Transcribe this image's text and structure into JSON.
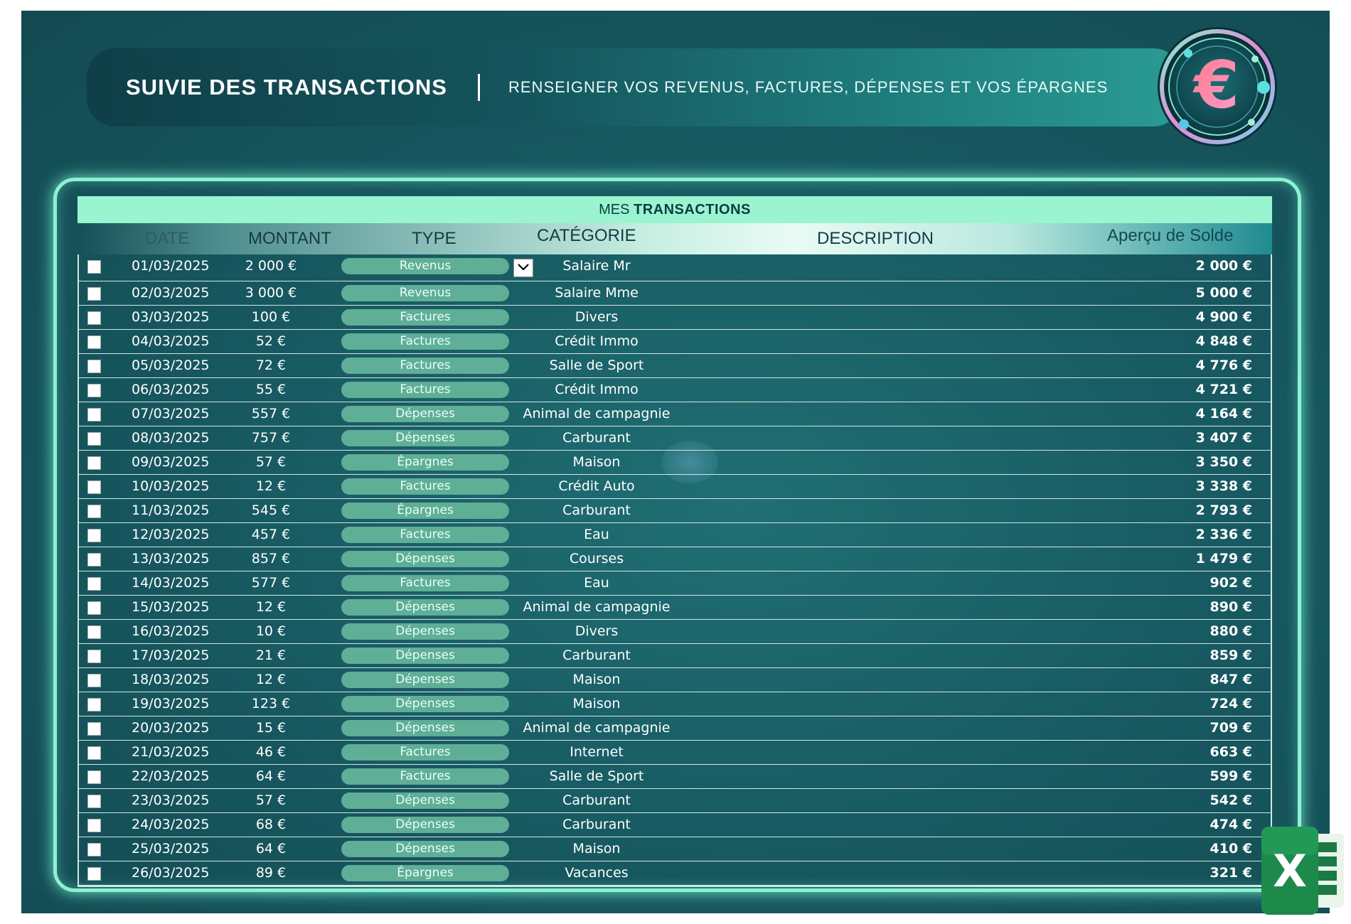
{
  "banner": {
    "title": "SUIVIE DES TRANSACTIONS",
    "subtitle": "RENSEIGNER VOS REVENUS, FACTURES, DÉPENSES ET VOS ÉPARGNES"
  },
  "icons": {
    "logo": "euro-coin-logo-icon",
    "excel": "excel-icon",
    "dropdown": "chevron-down-icon"
  },
  "colors": {
    "accent": "#9af4cf",
    "pill": "#5fae96",
    "background": "#17575f"
  },
  "table": {
    "title_prefix": "MES",
    "title_main": "TRANSACTIONS",
    "headers": {
      "date": "DATE",
      "amount": "MONTANT",
      "type": "TYPE",
      "category": "CATÉGORIE",
      "description": "DESCRIPTION",
      "balance": "Aperçu de Solde"
    },
    "rows": [
      {
        "date": "01/03/2025",
        "amount": "2 000 €",
        "type": "Revenus",
        "category": "Salaire Mr",
        "balance": "2 000 €"
      },
      {
        "date": "02/03/2025",
        "amount": "3 000 €",
        "type": "Revenus",
        "category": "Salaire Mme",
        "balance": "5 000 €"
      },
      {
        "date": "03/03/2025",
        "amount": "100 €",
        "type": "Factures",
        "category": "Divers",
        "balance": "4 900 €"
      },
      {
        "date": "04/03/2025",
        "amount": "52 €",
        "type": "Factures",
        "category": "Crédit Immo",
        "balance": "4 848 €"
      },
      {
        "date": "05/03/2025",
        "amount": "72 €",
        "type": "Factures",
        "category": "Salle de Sport",
        "balance": "4 776 €"
      },
      {
        "date": "06/03/2025",
        "amount": "55 €",
        "type": "Factures",
        "category": "Crédit Immo",
        "balance": "4 721 €"
      },
      {
        "date": "07/03/2025",
        "amount": "557 €",
        "type": "Dépenses",
        "category": "Animal de campagnie",
        "balance": "4 164 €"
      },
      {
        "date": "08/03/2025",
        "amount": "757 €",
        "type": "Dépenses",
        "category": "Carburant",
        "balance": "3 407 €"
      },
      {
        "date": "09/03/2025",
        "amount": "57 €",
        "type": "Épargnes",
        "category": "Maison",
        "balance": "3 350 €"
      },
      {
        "date": "10/03/2025",
        "amount": "12 €",
        "type": "Factures",
        "category": "Crédit Auto",
        "balance": "3 338 €"
      },
      {
        "date": "11/03/2025",
        "amount": "545 €",
        "type": "Épargnes",
        "category": "Carburant",
        "balance": "2 793 €"
      },
      {
        "date": "12/03/2025",
        "amount": "457 €",
        "type": "Factures",
        "category": "Eau",
        "balance": "2 336 €"
      },
      {
        "date": "13/03/2025",
        "amount": "857 €",
        "type": "Dépenses",
        "category": "Courses",
        "balance": "1 479 €"
      },
      {
        "date": "14/03/2025",
        "amount": "577 €",
        "type": "Factures",
        "category": "Eau",
        "balance": "902 €"
      },
      {
        "date": "15/03/2025",
        "amount": "12 €",
        "type": "Dépenses",
        "category": "Animal de campagnie",
        "balance": "890 €"
      },
      {
        "date": "16/03/2025",
        "amount": "10 €",
        "type": "Dépenses",
        "category": "Divers",
        "balance": "880 €"
      },
      {
        "date": "17/03/2025",
        "amount": "21 €",
        "type": "Dépenses",
        "category": "Carburant",
        "balance": "859 €"
      },
      {
        "date": "18/03/2025",
        "amount": "12 €",
        "type": "Dépenses",
        "category": "Maison",
        "balance": "847 €"
      },
      {
        "date": "19/03/2025",
        "amount": "123 €",
        "type": "Dépenses",
        "category": "Maison",
        "balance": "724 €"
      },
      {
        "date": "20/03/2025",
        "amount": "15 €",
        "type": "Dépenses",
        "category": "Animal de campagnie",
        "balance": "709 €"
      },
      {
        "date": "21/03/2025",
        "amount": "46 €",
        "type": "Factures",
        "category": "Internet",
        "balance": "663 €"
      },
      {
        "date": "22/03/2025",
        "amount": "64 €",
        "type": "Factures",
        "category": "Salle de Sport",
        "balance": "599 €"
      },
      {
        "date": "23/03/2025",
        "amount": "57 €",
        "type": "Dépenses",
        "category": "Carburant",
        "balance": "542 €"
      },
      {
        "date": "24/03/2025",
        "amount": "68 €",
        "type": "Dépenses",
        "category": "Carburant",
        "balance": "474 €"
      },
      {
        "date": "25/03/2025",
        "amount": "64 €",
        "type": "Dépenses",
        "category": "Maison",
        "balance": "410 €"
      },
      {
        "date": "26/03/2025",
        "amount": "89 €",
        "type": "Épargnes",
        "category": "Vacances",
        "balance": "321 €"
      }
    ]
  }
}
